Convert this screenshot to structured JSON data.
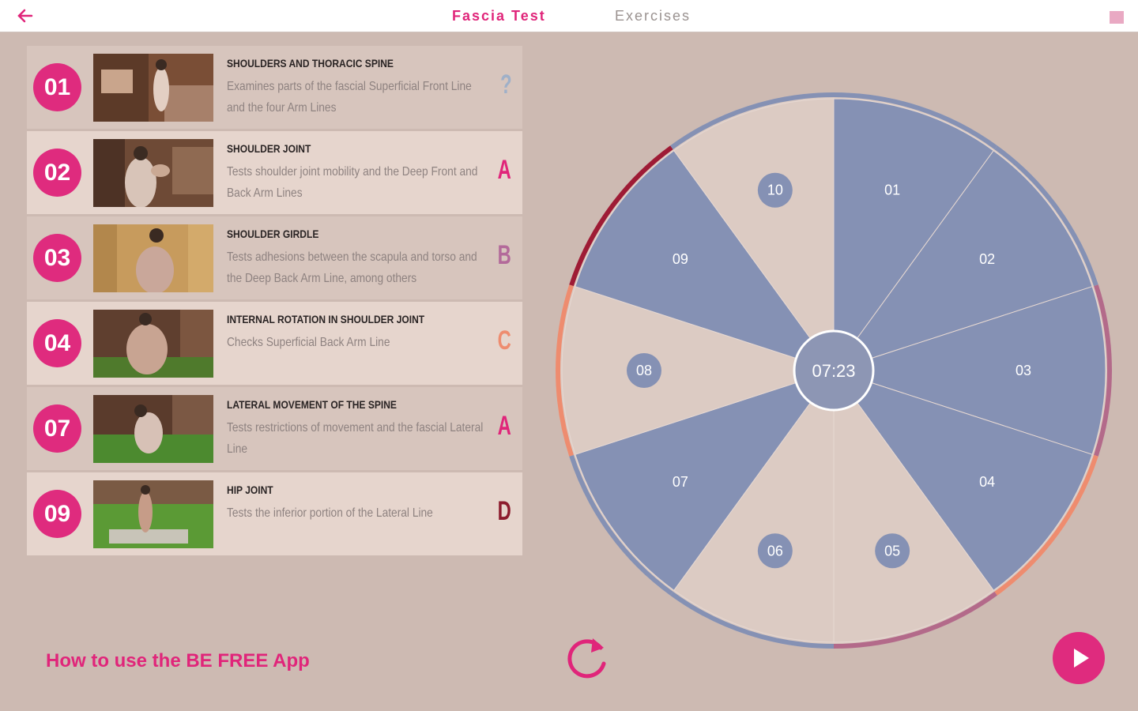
{
  "header": {
    "back_label": "back",
    "tabs": [
      {
        "label": "Fascia Test",
        "active": true
      },
      {
        "label": "Exercises",
        "active": false
      }
    ]
  },
  "exercises": [
    {
      "number": "01",
      "title": "SHOULDERS AND THORACIC SPINE",
      "description": "Examines parts of the fascial Superficial Front Line and the four Arm Lines",
      "grade": "?",
      "grade_color": "#9fb0c8"
    },
    {
      "number": "02",
      "title": "SHOULDER JOINT",
      "description": "Tests shoulder joint mobility and the Deep Front and Back Arm Lines",
      "grade": "A",
      "grade_color": "#e0257a"
    },
    {
      "number": "03",
      "title": "SHOULDER GIRDLE",
      "description": "Tests adhesions between the scapula and torso and the Deep Back Arm Line, among others",
      "grade": "B",
      "grade_color": "#b36a9a"
    },
    {
      "number": "04",
      "title": "INTERNAL ROTATION IN SHOULDER JOINT",
      "description": "Checks Superficial Back Arm Line",
      "grade": "C",
      "grade_color": "#ee8c6f"
    },
    {
      "number": "07",
      "title": "LATERAL MOVEMENT OF THE SPINE",
      "description": "Tests restrictions of movement and the fascial Lateral Line",
      "grade": "A",
      "grade_color": "#e0257a"
    },
    {
      "number": "09",
      "title": "HIP JOINT",
      "description": "Tests the inferior portion of the Lateral Line",
      "grade": "D",
      "grade_color": "#8c1b2d"
    }
  ],
  "wheel": {
    "timer": "07:23",
    "segments": [
      "01",
      "02",
      "03",
      "04",
      "05",
      "06",
      "07",
      "08",
      "09",
      "10"
    ],
    "completed": [
      "01",
      "02",
      "03",
      "04",
      "07",
      "09"
    ],
    "active_color": "#8591b4",
    "inactive_color": "#dccbc3"
  },
  "footer": {
    "help_link": "How to use the BE FREE App",
    "reset_icon": "refresh-icon",
    "play_icon": "play-icon"
  },
  "colors": {
    "accent": "#df2b7e",
    "background": "#cdbab2"
  }
}
